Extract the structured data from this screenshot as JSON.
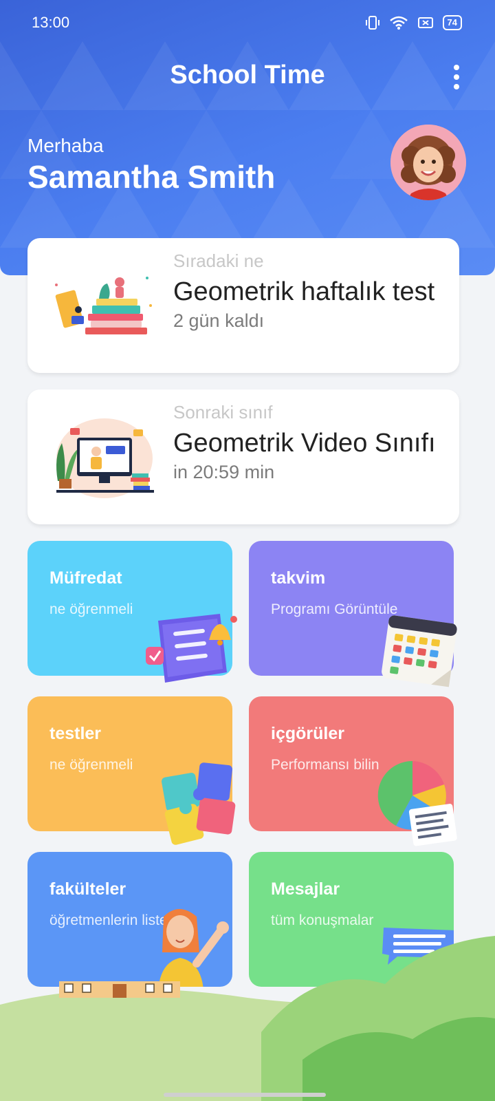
{
  "status_bar": {
    "time": "13:00",
    "battery": "74"
  },
  "header": {
    "title": "School Time",
    "greeting": "Merhaba",
    "user_name": "Samantha Smith"
  },
  "cards": [
    {
      "kicker": "Sıradaki ne",
      "title": "Geometrik haftalık test",
      "subtitle": "2 gün kaldı"
    },
    {
      "kicker": "Sonraki sınıf",
      "title": "Geometrik Video Sınıfı",
      "subtitle": "in 20:59 min"
    }
  ],
  "tiles": [
    {
      "title": "Müfredat",
      "subtitle": "ne öğrenmeli",
      "color": "#5cd2fa",
      "icon": "curriculum-scroll-icon"
    },
    {
      "title": "takvim",
      "subtitle": "Programı Görüntüle",
      "color": "#8c84f3",
      "icon": "calendar-icon"
    },
    {
      "title": "testler",
      "subtitle": "ne öğrenmeli",
      "color": "#fbbd57",
      "icon": "puzzle-icon"
    },
    {
      "title": "içgörüler",
      "subtitle": "Performansı bilin",
      "color": "#f27a7a",
      "icon": "pie-chart-icon"
    },
    {
      "title": "fakülteler",
      "subtitle": "öğretmenlerin listesi",
      "color": "#5b96f6",
      "icon": "teacher-icon"
    },
    {
      "title": "Mesajlar",
      "subtitle": "tüm konuşmalar",
      "color": "#76e08a",
      "icon": "chat-bubbles-icon"
    }
  ],
  "colors": {
    "header_gradient_start": "#3a63d8",
    "header_gradient_end": "#5a8cf5",
    "background": "#f2f4f7"
  }
}
